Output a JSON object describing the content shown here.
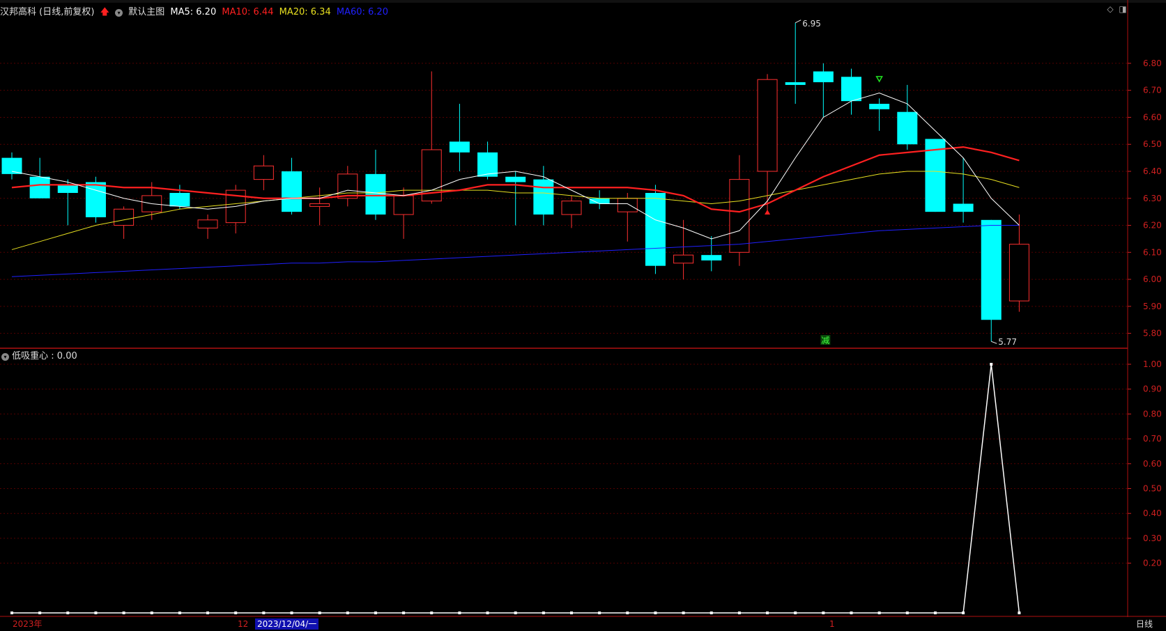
{
  "header": {
    "stock_name": "汉邦高科 (日线,前复权)",
    "main_chart_label": "默认主图",
    "ma5_label": "MA5: 6.20",
    "ma10_label": "MA10: 6.44",
    "ma20_label": "MA20: 6.34",
    "ma60_label": "MA60: 6.20"
  },
  "indicator_header": {
    "label": "低吸重心 : 0.00"
  },
  "bottom": {
    "year_label": "2023年",
    "month12_label": "12",
    "date_box": "2023/12/04/一",
    "month1_label": "1",
    "period_tab": "日线"
  },
  "annotations": {
    "high_label": "6.95",
    "low_label": "5.77",
    "reduce_marker": "减"
  },
  "colors": {
    "up": "#ff3030",
    "down": "#00ffff",
    "ma5": "#ffffff",
    "ma10": "#ff2020",
    "ma20": "#e8e020",
    "ma60": "#2020ff",
    "grid": "#550000",
    "axis": "#d02020"
  },
  "chart_data": [
    {
      "type": "candlestick",
      "ylim": [
        5.75,
        6.97
      ],
      "y_ticks": [
        "6.80",
        "6.70",
        "6.60",
        "6.50",
        "6.40",
        "6.30",
        "6.20",
        "6.10",
        "6.00",
        "5.90",
        "5.80"
      ],
      "candles": [
        {
          "o": 6.45,
          "c": 6.39,
          "h": 6.47,
          "l": 6.37
        },
        {
          "o": 6.38,
          "c": 6.3,
          "h": 6.45,
          "l": 6.3
        },
        {
          "o": 6.35,
          "c": 6.32,
          "h": 6.37,
          "l": 6.2
        },
        {
          "o": 6.36,
          "c": 6.23,
          "h": 6.38,
          "l": 6.21
        },
        {
          "o": 6.2,
          "c": 6.26,
          "h": 6.27,
          "l": 6.15
        },
        {
          "o": 6.25,
          "c": 6.31,
          "h": 6.36,
          "l": 6.22
        },
        {
          "o": 6.32,
          "c": 6.27,
          "h": 6.35,
          "l": 6.26
        },
        {
          "o": 6.19,
          "c": 6.22,
          "h": 6.24,
          "l": 6.15
        },
        {
          "o": 6.21,
          "c": 6.33,
          "h": 6.35,
          "l": 6.17
        },
        {
          "o": 6.37,
          "c": 6.42,
          "h": 6.46,
          "l": 6.33
        },
        {
          "o": 6.4,
          "c": 6.25,
          "h": 6.45,
          "l": 6.24
        },
        {
          "o": 6.27,
          "c": 6.28,
          "h": 6.34,
          "l": 6.2
        },
        {
          "o": 6.3,
          "c": 6.39,
          "h": 6.42,
          "l": 6.27
        },
        {
          "o": 6.39,
          "c": 6.24,
          "h": 6.48,
          "l": 6.22
        },
        {
          "o": 6.24,
          "c": 6.31,
          "h": 6.34,
          "l": 6.15
        },
        {
          "o": 6.29,
          "c": 6.48,
          "h": 6.77,
          "l": 6.28
        },
        {
          "o": 6.51,
          "c": 6.47,
          "h": 6.65,
          "l": 6.4
        },
        {
          "o": 6.47,
          "c": 6.38,
          "h": 6.51,
          "l": 6.37
        },
        {
          "o": 6.38,
          "c": 6.36,
          "h": 6.4,
          "l": 6.2
        },
        {
          "o": 6.37,
          "c": 6.24,
          "h": 6.42,
          "l": 6.2
        },
        {
          "o": 6.24,
          "c": 6.29,
          "h": 6.31,
          "l": 6.19
        },
        {
          "o": 6.3,
          "c": 6.28,
          "h": 6.33,
          "l": 6.26
        },
        {
          "o": 6.25,
          "c": 6.3,
          "h": 6.32,
          "l": 6.14
        },
        {
          "o": 6.32,
          "c": 6.05,
          "h": 6.35,
          "l": 6.02
        },
        {
          "o": 6.06,
          "c": 6.09,
          "h": 6.22,
          "l": 6.0
        },
        {
          "o": 6.09,
          "c": 6.07,
          "h": 6.16,
          "l": 6.03
        },
        {
          "o": 6.1,
          "c": 6.37,
          "h": 6.46,
          "l": 6.05
        },
        {
          "o": 6.4,
          "c": 6.74,
          "h": 6.76,
          "l": 6.25
        },
        {
          "o": 6.73,
          "c": 6.72,
          "h": 6.95,
          "l": 6.65
        },
        {
          "o": 6.77,
          "c": 6.73,
          "h": 6.8,
          "l": 6.6
        },
        {
          "o": 6.75,
          "c": 6.66,
          "h": 6.78,
          "l": 6.61
        },
        {
          "o": 6.65,
          "c": 6.63,
          "h": 6.67,
          "l": 6.55
        },
        {
          "o": 6.62,
          "c": 6.5,
          "h": 6.72,
          "l": 6.48
        },
        {
          "o": 6.52,
          "c": 6.25,
          "h": 6.52,
          "l": 6.25
        },
        {
          "o": 6.28,
          "c": 6.25,
          "h": 6.45,
          "l": 6.21
        },
        {
          "o": 6.22,
          "c": 5.85,
          "h": 6.22,
          "l": 5.77
        },
        {
          "o": 5.92,
          "c": 6.13,
          "h": 6.24,
          "l": 5.88
        }
      ],
      "ma5": [
        6.4,
        6.38,
        6.36,
        6.33,
        6.3,
        6.28,
        6.27,
        6.26,
        6.27,
        6.29,
        6.3,
        6.3,
        6.33,
        6.32,
        6.31,
        6.33,
        6.37,
        6.39,
        6.4,
        6.38,
        6.33,
        6.28,
        6.28,
        6.22,
        6.19,
        6.15,
        6.18,
        6.29,
        6.45,
        6.6,
        6.66,
        6.69,
        6.65,
        6.55,
        6.45,
        6.3,
        6.2
      ],
      "ma10": [
        6.34,
        6.35,
        6.35,
        6.35,
        6.34,
        6.34,
        6.33,
        6.32,
        6.31,
        6.3,
        6.3,
        6.3,
        6.31,
        6.31,
        6.31,
        6.32,
        6.33,
        6.35,
        6.35,
        6.34,
        6.34,
        6.34,
        6.34,
        6.33,
        6.31,
        6.26,
        6.25,
        6.28,
        6.33,
        6.38,
        6.42,
        6.46,
        6.47,
        6.48,
        6.49,
        6.47,
        6.44
      ],
      "ma20": [
        6.11,
        6.14,
        6.17,
        6.2,
        6.22,
        6.24,
        6.26,
        6.27,
        6.28,
        6.29,
        6.3,
        6.31,
        6.32,
        6.32,
        6.33,
        6.33,
        6.33,
        6.33,
        6.32,
        6.32,
        6.31,
        6.3,
        6.3,
        6.3,
        6.29,
        6.28,
        6.29,
        6.31,
        6.33,
        6.35,
        6.37,
        6.39,
        6.4,
        6.4,
        6.39,
        6.37,
        6.34
      ],
      "ma60": [
        6.01,
        6.015,
        6.02,
        6.025,
        6.03,
        6.035,
        6.04,
        6.045,
        6.05,
        6.055,
        6.06,
        6.06,
        6.065,
        6.065,
        6.07,
        6.075,
        6.08,
        6.085,
        6.09,
        6.095,
        6.1,
        6.105,
        6.11,
        6.115,
        6.12,
        6.125,
        6.13,
        6.14,
        6.15,
        6.16,
        6.17,
        6.18,
        6.185,
        6.19,
        6.195,
        6.2,
        6.2
      ]
    },
    {
      "type": "line",
      "name": "低吸重心",
      "ylim": [
        0,
        1.0
      ],
      "y_ticks": [
        "1.00",
        "0.90",
        "0.80",
        "0.70",
        "0.60",
        "0.50",
        "0.40",
        "0.30",
        "0.20"
      ],
      "values": [
        0,
        0,
        0,
        0,
        0,
        0,
        0,
        0,
        0,
        0,
        0,
        0,
        0,
        0,
        0,
        0,
        0,
        0,
        0,
        0,
        0,
        0,
        0,
        0,
        0,
        0,
        0,
        0,
        0,
        0,
        0,
        0,
        0,
        0,
        0,
        1,
        0
      ]
    }
  ]
}
